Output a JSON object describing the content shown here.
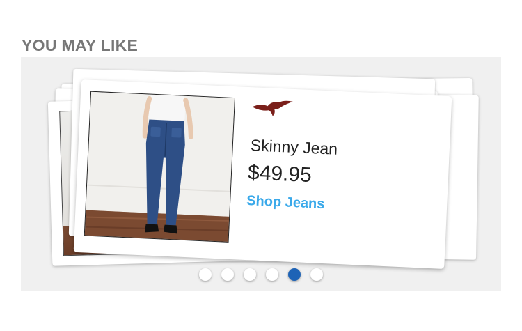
{
  "section": {
    "title": "YOU MAY LIKE"
  },
  "product": {
    "name": "Skinny Jean",
    "price": "$49.95",
    "cta": "Shop Jeans",
    "logo_icon": "seagull-logo-icon",
    "image": "model wearing skinny jeans, rear view"
  },
  "carousel": {
    "page_count": 6,
    "active_index": 4
  },
  "colors": {
    "heading": "#777777",
    "link": "#3aa9ea",
    "dot_active": "#1e63b6",
    "dot_inactive": "#ffffff",
    "panel_bg": "#f0f0f0",
    "logo": "#7a1f1a"
  }
}
